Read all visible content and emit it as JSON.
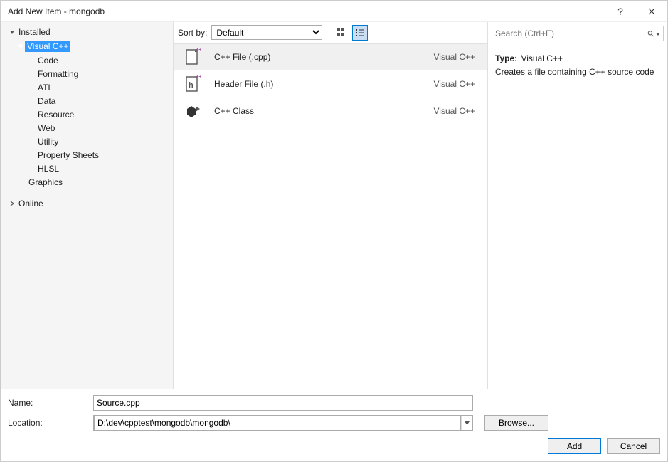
{
  "window": {
    "title": "Add New Item - mongodb"
  },
  "sidebar": {
    "installed": "Installed",
    "vcpp": "Visual C++",
    "children": [
      "Code",
      "Formatting",
      "ATL",
      "Data",
      "Resource",
      "Web",
      "Utility",
      "Property Sheets",
      "HLSL"
    ],
    "graphics": "Graphics",
    "online": "Online"
  },
  "toolbar": {
    "sort_label": "Sort by:",
    "sort_value": "Default"
  },
  "items": [
    {
      "name": "C++ File (.cpp)",
      "lang": "Visual C++"
    },
    {
      "name": "Header File (.h)",
      "lang": "Visual C++"
    },
    {
      "name": "C++ Class",
      "lang": "Visual C++"
    }
  ],
  "search": {
    "placeholder": "Search (Ctrl+E)"
  },
  "detail": {
    "type_label": "Type:",
    "type_value": "Visual C++",
    "description": "Creates a file containing C++ source code"
  },
  "form": {
    "name_label": "Name:",
    "name_value": "Source.cpp",
    "location_label": "Location:",
    "location_value": "D:\\dev\\cpptest\\mongodb\\mongodb\\",
    "browse": "Browse..."
  },
  "buttons": {
    "add": "Add",
    "cancel": "Cancel"
  }
}
